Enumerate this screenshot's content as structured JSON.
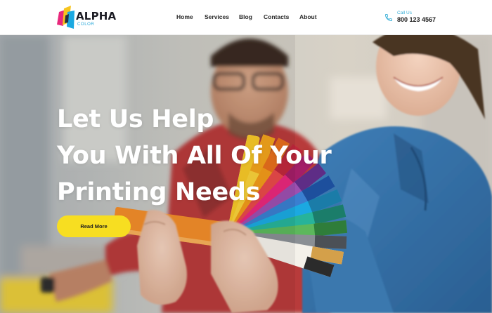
{
  "header": {
    "logo": {
      "name": "ALPHA",
      "sub": "COLOR"
    },
    "nav": [
      {
        "label": "Home"
      },
      {
        "label": "Services"
      },
      {
        "label": "Blog"
      },
      {
        "label": "Contacts"
      },
      {
        "label": "About"
      }
    ],
    "call": {
      "label": "Call Us",
      "number": "800 123 4567",
      "icon": "phone-icon"
    }
  },
  "hero": {
    "title_lines": [
      "Let Us Help",
      "You With All Of Your",
      "Printing Needs"
    ],
    "cta_label": "Read More",
    "background": "photo of two people holding a color swatch fan"
  },
  "colors": {
    "accent_yellow": "#f7de21",
    "accent_blue": "#3ab0d8",
    "logo_magenta": "#e8287c",
    "text_dark": "#1c1c24"
  }
}
